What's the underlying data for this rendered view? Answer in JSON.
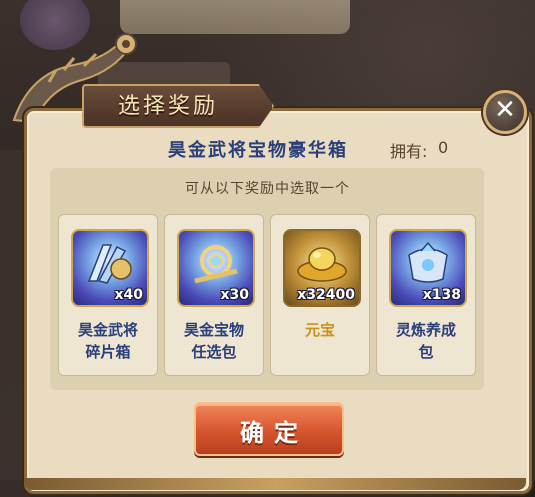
{
  "dialog": {
    "title": "选择奖励",
    "close_label": "✕",
    "chest_name": "昊金武将宝物豪华箱",
    "owned_label": "拥有:",
    "owned_value": "0",
    "hint": "可从以下奖励中选取一个",
    "confirm_label": "确定"
  },
  "rewards": [
    {
      "name_line1": "昊金武将",
      "name_line2": "碎片箱",
      "quantity": "x40",
      "icon": "fan-general-icon"
    },
    {
      "name_line1": "昊金宝物",
      "name_line2": "任选包",
      "quantity": "x30",
      "icon": "treasure-bundle-icon"
    },
    {
      "name_line1": "元宝",
      "name_line2": "",
      "quantity": "x32400",
      "icon": "gold-ingot-icon"
    },
    {
      "name_line1": "灵炼养成",
      "name_line2": "包",
      "quantity": "x138",
      "icon": "refine-pack-icon"
    }
  ],
  "colors": {
    "panel": "#e9dcc0",
    "title_text": "#f6e3b4",
    "reward_name": "#2a3f7a",
    "gold_name": "#c9921a",
    "confirm": "#d8552e"
  }
}
